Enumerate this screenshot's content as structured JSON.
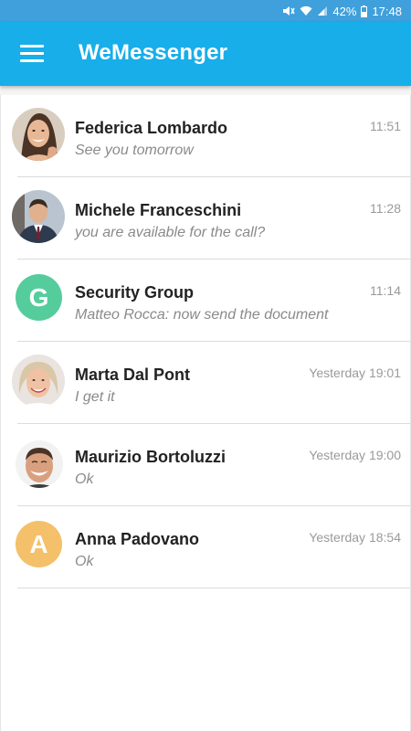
{
  "status_bar": {
    "battery": "42%",
    "time": "17:48",
    "icons": [
      "mute-icon",
      "wifi-icon",
      "signal-icon",
      "battery-icon"
    ]
  },
  "app_bar": {
    "title": "WeMessenger",
    "menu_icon": "hamburger-menu-icon"
  },
  "colors": {
    "status_bar": "#3fa0dc",
    "app_bar": "#18aeea",
    "avatar_security_group": "#55cc9c",
    "avatar_anna": "#f4c069"
  },
  "chats": [
    {
      "name": "Federica Lombardo",
      "message": "See you tomorrow",
      "time": "11:51",
      "avatar": "photo-woman-smiling"
    },
    {
      "name": "Michele Franceschini",
      "message": "you are available for the call?",
      "time": "11:28",
      "avatar": "photo-man-in-suit"
    },
    {
      "name": "Security Group",
      "message": "Matteo Rocca: now send the document",
      "time": "11:14",
      "avatar_letter": "G"
    },
    {
      "name": "Marta Dal Pont",
      "message": "I get it",
      "time": "Yesterday 19:01",
      "avatar": "photo-older-woman"
    },
    {
      "name": "Maurizio Bortoluzzi",
      "message": "Ok",
      "time": "Yesterday 19:00",
      "avatar": "photo-man-laughing"
    },
    {
      "name": "Anna Padovano",
      "message": "Ok",
      "time": "Yesterday 18:54",
      "avatar_letter": "A"
    }
  ]
}
